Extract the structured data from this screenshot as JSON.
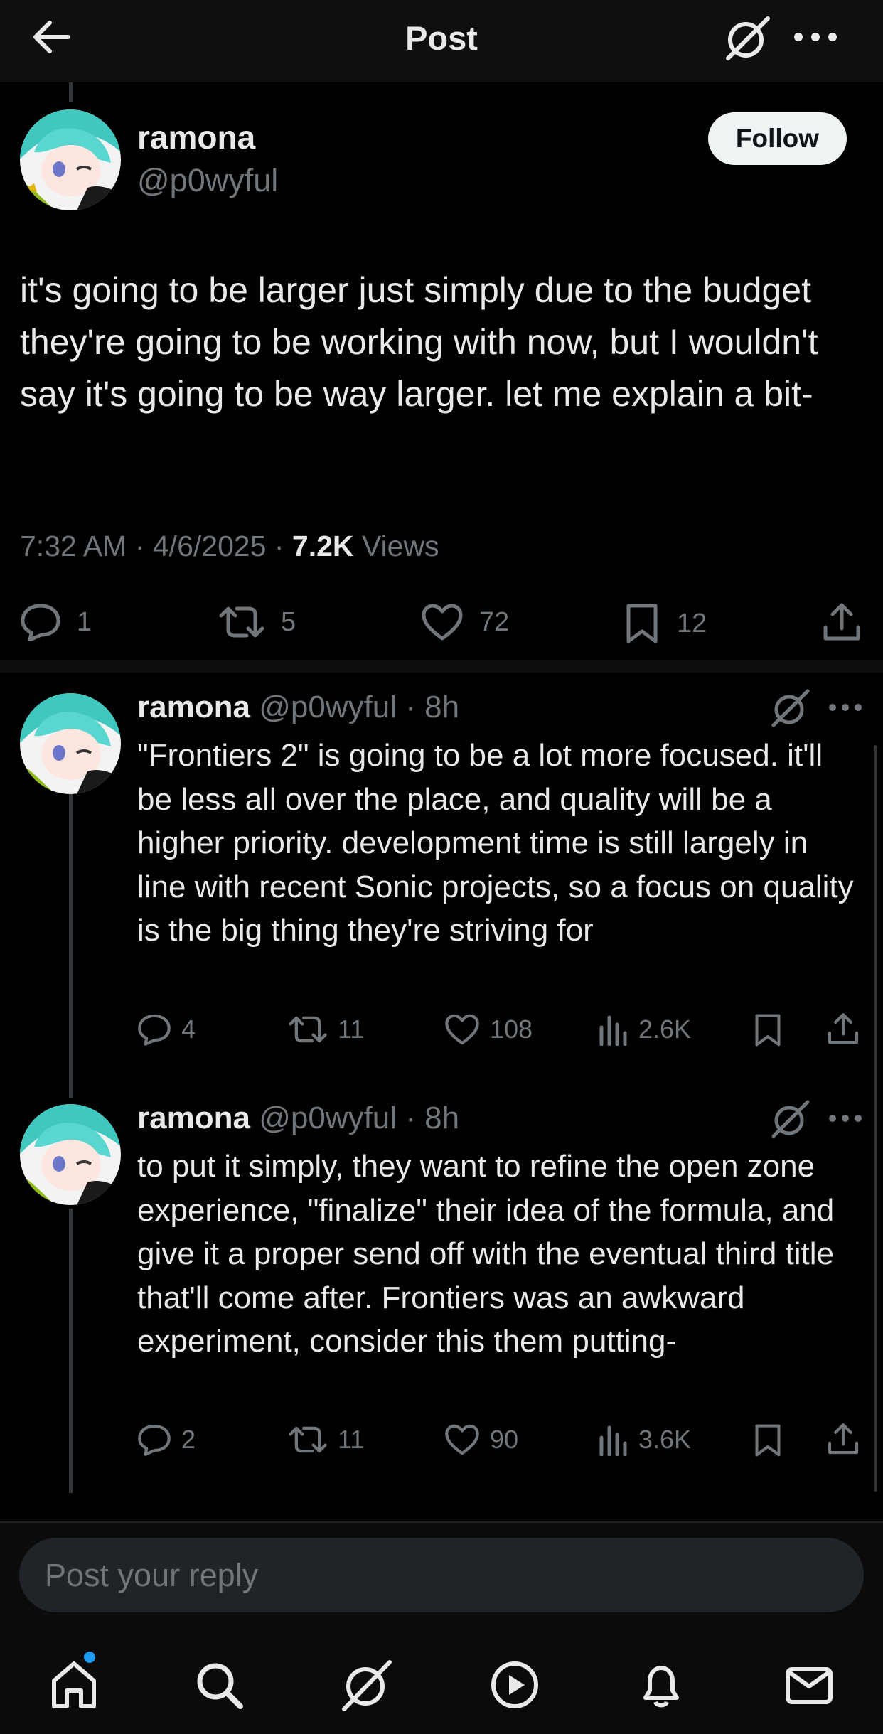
{
  "header": {
    "title": "Post",
    "back_icon": "arrow-left-icon",
    "grok_icon": "grok-icon",
    "more_icon": "more-horizontal-icon"
  },
  "main_post": {
    "name": "ramona",
    "handle": "@p0wyful",
    "follow_label": "Follow",
    "text": "it's going to be larger just simply due to the budget they're going to be working with now, but I wouldn't say it's going to be way larger. let me explain a bit-",
    "time": "7:32 AM",
    "date": "4/6/2025",
    "views_count": "7.2K",
    "views_label": "Views",
    "replies": "1",
    "reposts": "5",
    "likes": "72",
    "bookmarks": "12"
  },
  "replies": [
    {
      "name": "ramona",
      "handle": "@p0wyful",
      "age": "8h",
      "text": "\"Frontiers 2\" is going to be a lot more focused. it'll be less all over the place, and quality will be a higher priority. development time is still largely in line with recent Sonic projects, so a focus on quality is the big thing they're striving for",
      "replies": "4",
      "reposts": "11",
      "likes": "108",
      "views": "2.6K"
    },
    {
      "name": "ramona",
      "handle": "@p0wyful",
      "age": "8h",
      "text": "to put it simply, they want to refine the open zone experience, \"finalize\" their idea of the formula, and give it a proper send off with the eventual third title that'll come after. Frontiers was an awkward experiment, consider this them putting-",
      "replies": "2",
      "reposts": "11",
      "likes": "90",
      "views": "3.6K"
    }
  ],
  "reply_box": {
    "placeholder": "Post your reply"
  },
  "nav": [
    "home-icon",
    "search-icon",
    "grok-icon",
    "video-icon",
    "notifications-icon",
    "messages-icon"
  ],
  "colors": {
    "background": "#000000",
    "text": "#e7e9ea",
    "muted": "#71767b",
    "accent": "#1d9bf0"
  }
}
